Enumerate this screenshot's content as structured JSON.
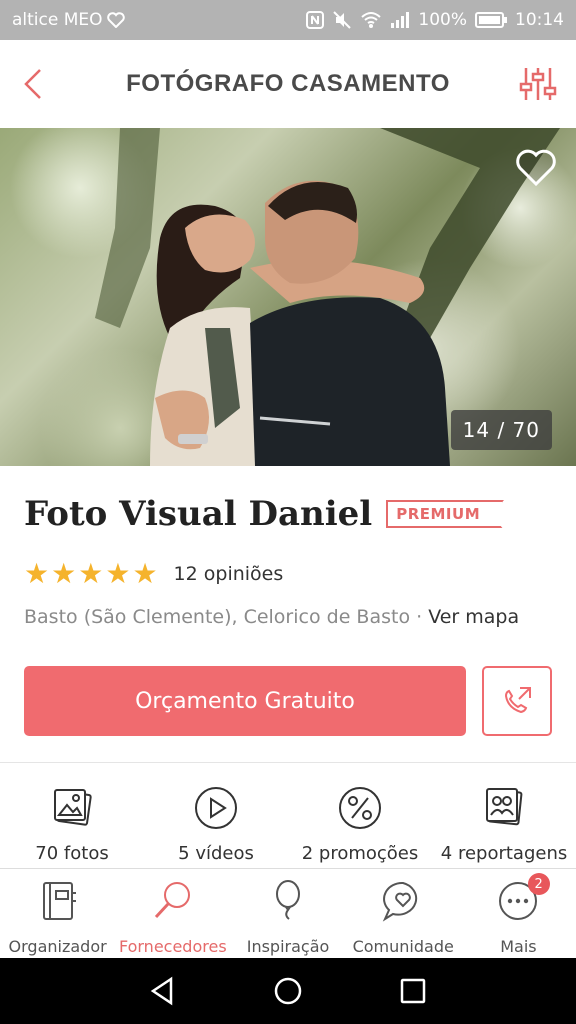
{
  "status_bar": {
    "carrier": "altice MEO",
    "battery": "100%",
    "time": "10:14"
  },
  "header": {
    "title": "FOTÓGRAFO CASAMENTO"
  },
  "gallery": {
    "counter": "14 / 70"
  },
  "vendor": {
    "name": "Foto Visual Daniel",
    "badge": "PREMIUM",
    "rating": 5,
    "reviews": "12 opiniões",
    "location": "Basto (São Clemente), Celorico de Basto",
    "separator": " · ",
    "map_link": "Ver mapa",
    "cta": "Orçamento Gratuito"
  },
  "media": [
    {
      "label": "70 fotos",
      "icon": "photos-icon"
    },
    {
      "label": "5 vídeos",
      "icon": "video-play-icon"
    },
    {
      "label": "2 promoções",
      "icon": "percent-icon"
    },
    {
      "label": "4 reportagens",
      "icon": "album-icon"
    }
  ],
  "tabs": [
    {
      "label": "Organizador",
      "icon": "notebook-icon"
    },
    {
      "label": "Fornecedores",
      "icon": "magnifier-icon",
      "active": true
    },
    {
      "label": "Inspiração",
      "icon": "balloon-icon"
    },
    {
      "label": "Comunidade",
      "icon": "chat-heart-icon"
    },
    {
      "label": "Mais",
      "icon": "more-icon",
      "badge": "2"
    }
  ],
  "colors": {
    "accent": "#f06b6f",
    "star": "#f5b32c",
    "status_bar": "#b3b3b3"
  }
}
